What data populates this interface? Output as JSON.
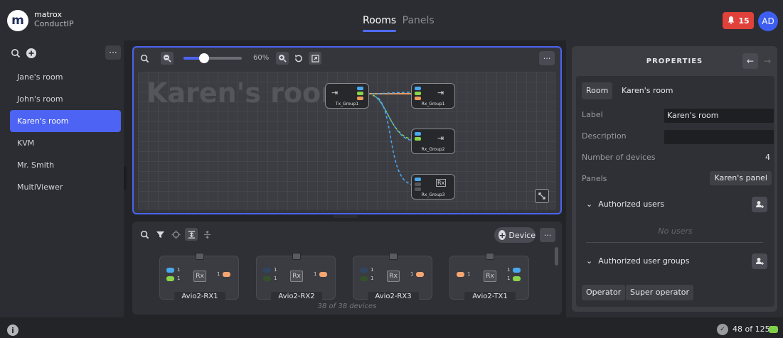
{
  "header": {
    "brand_line1": "matrox",
    "brand_line2": "ConductIP",
    "logo_letter": "m",
    "tabs": [
      {
        "label": "Rooms",
        "active": true
      },
      {
        "label": "Panels",
        "active": false
      }
    ],
    "alarm_count": "15",
    "avatar_initials": "AD"
  },
  "sidebar": {
    "more_label": "···",
    "rooms": [
      {
        "label": "Jane's room",
        "active": false
      },
      {
        "label": "John's room",
        "active": false
      },
      {
        "label": "Karen's room",
        "active": true
      },
      {
        "label": "KVM",
        "active": false
      },
      {
        "label": "Mr. Smith",
        "active": false
      },
      {
        "label": "MultiViewer",
        "active": false
      }
    ]
  },
  "canvas": {
    "zoom_label": "60%",
    "zoom_fraction": 0.35,
    "more_label": "···",
    "room_title": "Karen's room",
    "nodes": [
      {
        "label": "Tx_Group1"
      },
      {
        "label": "Rx_Group1"
      },
      {
        "label": "Rx_Group2"
      },
      {
        "label": "Rx_Group3"
      }
    ]
  },
  "devices": {
    "add_label": "Device",
    "more_label": "···",
    "count_label": "38 of 38 devices",
    "items": [
      {
        "name": "Avio2-RX1"
      },
      {
        "name": "Avio2-RX2"
      },
      {
        "name": "Avio2-RX3"
      },
      {
        "name": "Avio2-TX1"
      }
    ]
  },
  "properties": {
    "title": "PROPERTIES",
    "type_label": "Room",
    "room_name": "Karen's room",
    "label_label": "Label",
    "label_value": "Karen's room",
    "description_label": "Description",
    "description_value": "",
    "num_devices_label": "Number of devices",
    "num_devices_value": "4",
    "panels_label": "Panels",
    "panels_value": "Karen's panel",
    "authorized_users_label": "Authorized users",
    "no_users_label": "No users",
    "authorized_groups_label": "Authorized user groups",
    "groups": [
      "Operator",
      "Super operator"
    ]
  },
  "footer": {
    "device_count": "48 of 125"
  },
  "colors": {
    "accent": "#4d63f3",
    "alarm": "#e0413a",
    "status_green": "#7ed048"
  }
}
